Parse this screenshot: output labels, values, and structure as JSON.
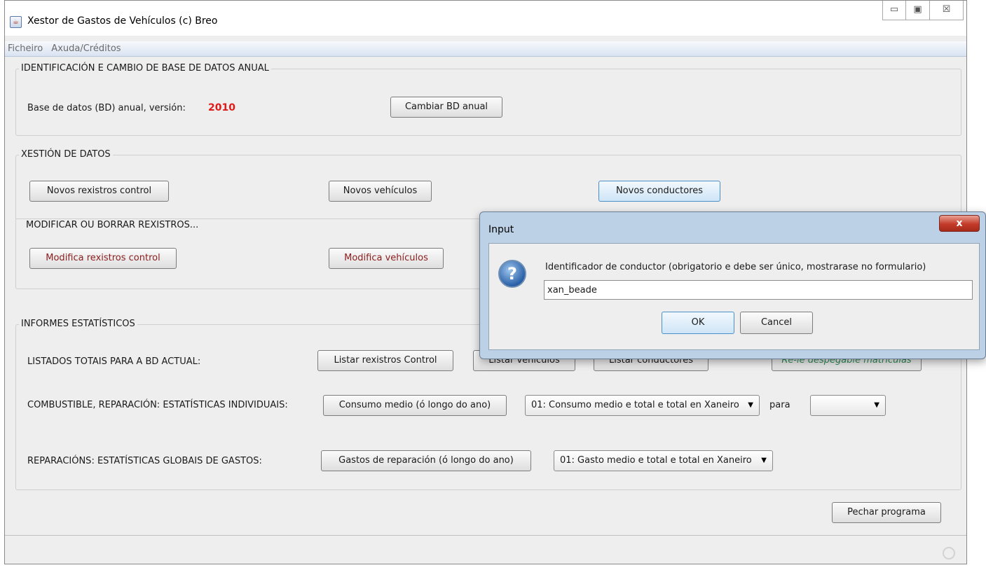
{
  "window": {
    "title": "Xestor de Gastos de Vehículos (c) Breo",
    "controls": {
      "minimize": "▭",
      "maximize": "▣",
      "close": "☒"
    }
  },
  "menu": {
    "items": [
      "Ficheiro",
      "Axuda/Créditos"
    ]
  },
  "identification": {
    "title": "IDENTIFICACIÓN E CAMBIO DE BASE DE DATOS ANUAL",
    "db_label": "Base de datos (BD) anual, versión:",
    "db_year": "2010",
    "change_button": "Cambiar BD anual"
  },
  "management": {
    "title": "XESTIÓN DE DATOS",
    "new_control": "Novos rexistros control",
    "new_vehicles": "Novos vehículos",
    "new_drivers": "Novos conductores",
    "modify_title": "MODIFICAR OU BORRAR REXISTROS...",
    "modify_control": "Modifica rexistros control",
    "modify_vehicles": "Modifica vehículos"
  },
  "reports": {
    "title": "INFORMES ESTATÍSTICOS",
    "listings_label": "LISTADOS TOTAIS PARA A BD ACTUAL:",
    "list_control": "Listar rexistros Control",
    "list_vehicles": "Listar vehículos",
    "list_drivers": "Listar conductores",
    "reload_plates": "Re-le despegable matrículas",
    "individual_label": "COMBUSTIBLE, REPARACIÓN: ESTATÍSTICAS INDIVIDUAIS:",
    "avg_consumption": "Consumo medio (ó longo do ano)",
    "consumption_select": "01: Consumo medio e total e total en Xaneiro",
    "para": "para",
    "plate_select": "",
    "global_label": "REPARACIÓNS: ESTATÍSTICAS GLOBAIS DE GASTOS:",
    "repair_costs": "Gastos de reparación (ó longo do ano)",
    "repair_select": "01: Gasto medio e total e total en Xaneiro"
  },
  "footer": {
    "close_button": "Pechar programa"
  },
  "dialog": {
    "title": "Input",
    "close": "x",
    "icon": "?",
    "message": "Identificador de conductor (obrigatorio e debe ser único, mostrarase no formulario)",
    "input_value": "xan_beade",
    "ok": "OK",
    "cancel": "Cancel"
  },
  "colors": {
    "year": "#e01919",
    "menubar": "#d9e3f2",
    "dialog_frame": "#bcd0e6"
  }
}
